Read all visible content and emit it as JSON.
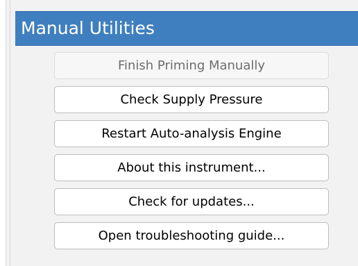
{
  "panel": {
    "title": "Manual Utilities",
    "header_color": "#3f7fbf"
  },
  "buttons": [
    {
      "label": "Finish Priming Manually",
      "enabled": false
    },
    {
      "label": "Check Supply Pressure",
      "enabled": true
    },
    {
      "label": "Restart Auto-analysis Engine",
      "enabled": true
    },
    {
      "label": "About this instrument...",
      "enabled": true
    },
    {
      "label": "Check for updates...",
      "enabled": true
    },
    {
      "label": "Open troubleshooting guide...",
      "enabled": true
    }
  ]
}
